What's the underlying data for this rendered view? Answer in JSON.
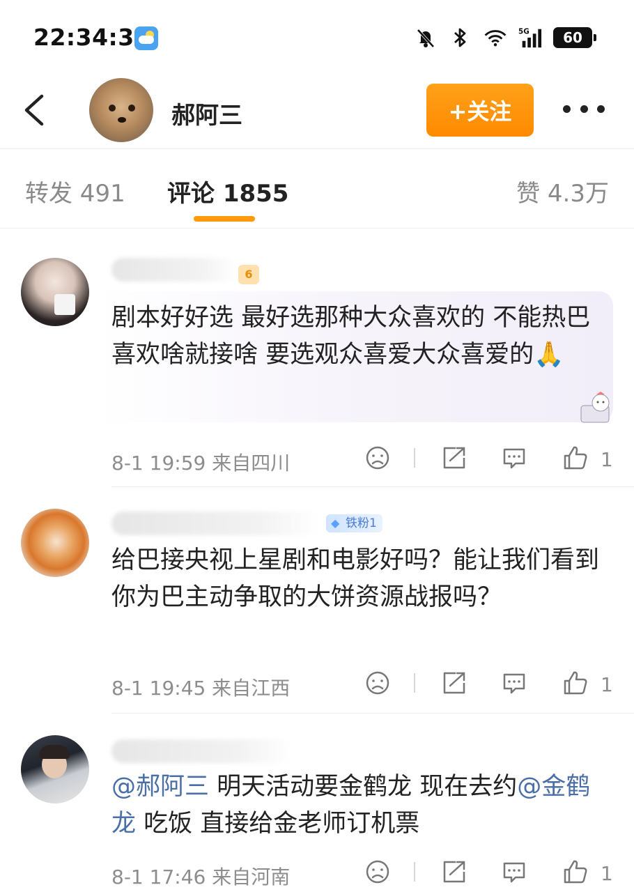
{
  "status_bar": {
    "time": "22:34:30",
    "battery": "60",
    "network": "5G"
  },
  "header": {
    "username": "郝阿三",
    "follow_label": "+关注"
  },
  "tabs": [
    {
      "label": "转发 491"
    },
    {
      "label": "评论 1855"
    },
    {
      "label": "赞 4.3万"
    }
  ],
  "comments": [
    {
      "text": "剧本好好选 最好选那种大众喜欢的 不能热巴喜欢啥就接啥 要选观众喜爱大众喜爱的🙏",
      "time": "8-1 19:59",
      "location": "来自四川",
      "likes": "1",
      "fan_level": "6"
    },
    {
      "badge": "铁粉1",
      "text": "给巴接央视上星剧和电影好吗？能让我们看到你为巴主动争取的大饼资源战报吗？",
      "time": "8-1 19:45",
      "location": "来自江西",
      "likes": "1"
    },
    {
      "mention1": "@郝阿三",
      "text_mid": " 明天活动要金鹤龙 现在去约",
      "mention2": "@金鹤龙",
      "text_end": " 吃饭 直接给金老师订机票",
      "time": "8-1 17:46",
      "location": "来自河南",
      "likes": "1"
    }
  ]
}
